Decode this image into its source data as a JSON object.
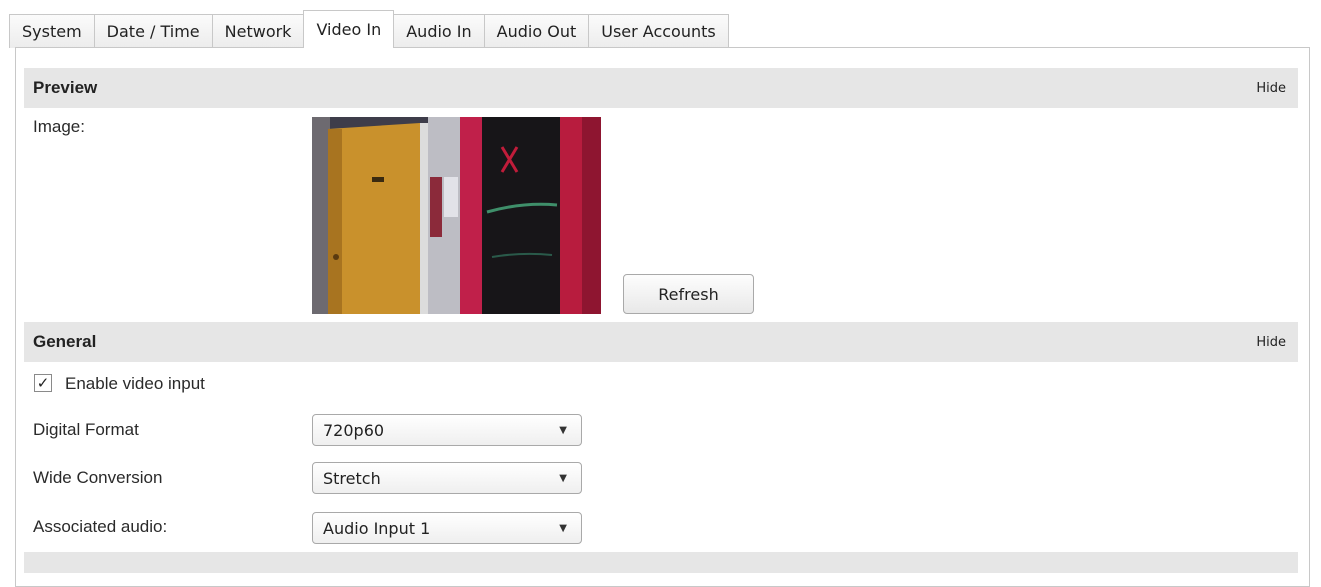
{
  "tabs": [
    {
      "label": "System",
      "active": false
    },
    {
      "label": "Date / Time",
      "active": false
    },
    {
      "label": "Network",
      "active": false
    },
    {
      "label": "Video In",
      "active": true
    },
    {
      "label": "Audio In",
      "active": false
    },
    {
      "label": "Audio Out",
      "active": false
    },
    {
      "label": "User Accounts",
      "active": false
    }
  ],
  "preview": {
    "title": "Preview",
    "hide_label": "Hide",
    "image_label": "Image:",
    "refresh_label": "Refresh"
  },
  "general": {
    "title": "General",
    "hide_label": "Hide",
    "enable_video_input": {
      "label": "Enable video input",
      "checked": true,
      "check_glyph": "✓"
    },
    "digital_format": {
      "label": "Digital Format",
      "value": "720p60"
    },
    "wide_conversion": {
      "label": "Wide Conversion",
      "value": "Stretch"
    },
    "associated_audio": {
      "label": "Associated audio:",
      "value": "Audio Input 1"
    }
  }
}
